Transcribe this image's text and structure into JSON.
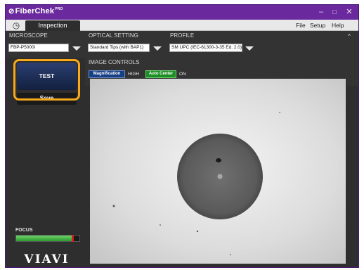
{
  "app": {
    "title": "FiberChek",
    "title_sup": "PRO"
  },
  "window_controls": {
    "minimize": "–",
    "maximize": "□",
    "close": "✕"
  },
  "tabs": [
    {
      "label": "Inspection"
    }
  ],
  "menu": {
    "file": "File",
    "setup": "Setup",
    "help": "Help"
  },
  "settings": {
    "microscope": {
      "label": "MICROSCOPE",
      "value": "FBP-P5000i"
    },
    "optical": {
      "label": "OPTICAL SETTING",
      "value": "Standard Tips (with BAP1)"
    },
    "profile": {
      "label": "PROFILE",
      "value": "SM UPC (IEC-61300-3-35 Ed. 2.0)"
    }
  },
  "left_panel": {
    "test_label": "TEST",
    "save_label": "Save",
    "focus_label": "FOCUS",
    "focus_level": 0.9,
    "brand": "VIAVI"
  },
  "image_controls": {
    "label": "IMAGE CONTROLS",
    "magnification_label": "Magnification",
    "magnification_value": "HIGH",
    "auto_center_label": "Auto Center",
    "auto_center_value": "ON"
  },
  "colors": {
    "titlebar": "#6a2a9e",
    "highlight": "#f7a81b",
    "test_button": "#1f3160",
    "magnification": "#173f86",
    "auto_center": "#1d8e26"
  }
}
